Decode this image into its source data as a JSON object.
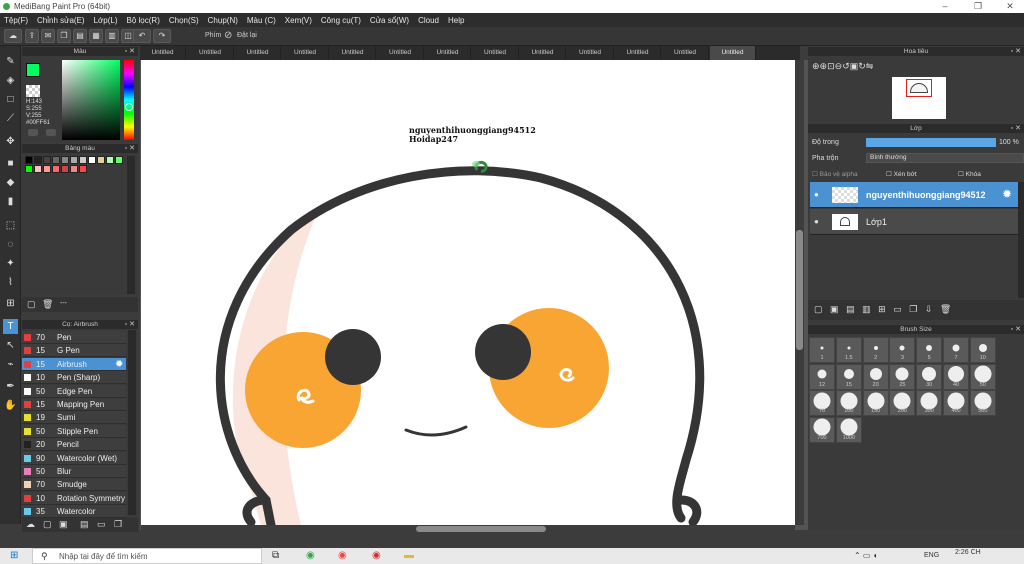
{
  "window": {
    "title": "MediBang Paint Pro (64bit)"
  },
  "menu": [
    "Tệp(F)",
    "Chỉnh sửa(E)",
    "Lớp(L)",
    "Bộ lọc(R)",
    "Chọn(S)",
    "Chụp(N)",
    "Màu (C)",
    "Xem(V)",
    "Công cụ(T)",
    "Cửa sổ(W)",
    "Cloud",
    "Help"
  ],
  "toolbar": {
    "phim_label": "Phím",
    "reset_label": "Đặt lại"
  },
  "color_panel": {
    "title": "Màu",
    "h": "H:143",
    "s": "S:255",
    "v": "V:255",
    "hex": "#00FF61",
    "fg": "#00ff61"
  },
  "palette_panel": {
    "title": "Bảng màu",
    "dash": "---"
  },
  "brush_panel": {
    "title": "Cọ: Airbrush",
    "items": [
      {
        "size": "70",
        "name": "Pen",
        "color": "#e04040"
      },
      {
        "size": "15",
        "name": "G Pen",
        "color": "#e04040"
      },
      {
        "size": "15",
        "name": "Airbrush",
        "color": "#e04040"
      },
      {
        "size": "10",
        "name": "Pen (Sharp)",
        "color": "#ffffff"
      },
      {
        "size": "50",
        "name": "Edge Pen",
        "color": "#ffffff"
      },
      {
        "size": "15",
        "name": "Mapping Pen",
        "color": "#e04040"
      },
      {
        "size": "19",
        "name": "Sumi",
        "color": "#e8e030"
      },
      {
        "size": "50",
        "name": "Stipple Pen",
        "color": "#e8e030"
      },
      {
        "size": "20",
        "name": "Pencil",
        "color": "#222222"
      },
      {
        "size": "90",
        "name": "Watercolor (Wet)",
        "color": "#6ac8e8"
      },
      {
        "size": "50",
        "name": "Blur",
        "color": "#e880c0"
      },
      {
        "size": "70",
        "name": "Smudge",
        "color": "#f0d0b0"
      },
      {
        "size": "10",
        "name": "Rotation Symmetry",
        "color": "#e04040"
      },
      {
        "size": "35",
        "name": "Watercolor",
        "color": "#6ac8e8"
      }
    ]
  },
  "tabs": [
    "Untitled",
    "Untitled",
    "Untitled",
    "Untitled",
    "Untitled",
    "Untitled",
    "Untitled",
    "Untitled",
    "Untitled",
    "Untitled",
    "Untitled",
    "Untitled",
    "Untitled"
  ],
  "canvas": {
    "text1": "nguyenthihuonggiang94512",
    "text2": "Hoidap247"
  },
  "navigator": {
    "title": "Hoa tiêu"
  },
  "layer_panel": {
    "title": "Lớp",
    "opacity_label": "Độ trong",
    "opacity_value": "100 %",
    "opacity": 100,
    "blend_label": "Pha trộn",
    "blend_value": "Bình thường",
    "protect_alpha": "Bảo vệ alpha",
    "clip": "Xén bớt",
    "lock": "Khóa",
    "layers": [
      {
        "name": "nguyenthihuonggiang94512",
        "selected": true
      },
      {
        "name": "Lớp1",
        "selected": false
      }
    ]
  },
  "brush_size_panel": {
    "title": "Brush Size",
    "sizes": [
      "1",
      "1.5",
      "2",
      "3",
      "5",
      "7",
      "10",
      "12",
      "15",
      "20",
      "25",
      "30",
      "40",
      "50",
      "70",
      "100",
      "150",
      "200",
      "300",
      "400",
      "500",
      "700",
      "1000"
    ]
  },
  "taskbar": {
    "search_placeholder": "Nhập tại đây để tìm kiếm",
    "lang": "ENG",
    "time": "2:26 CH"
  }
}
